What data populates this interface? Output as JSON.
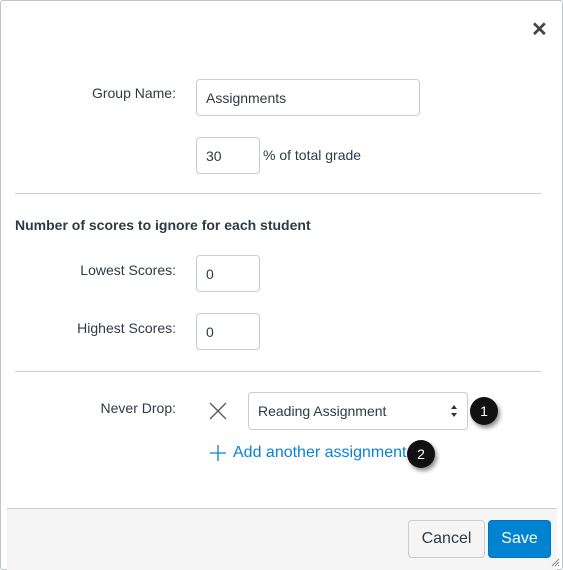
{
  "close_icon": "close-icon",
  "group_name": {
    "label": "Group Name:",
    "value": "Assignments"
  },
  "percent": {
    "value": "30",
    "suffix": "% of total grade"
  },
  "drop_section": {
    "heading": "Number of scores to ignore for each student",
    "lowest": {
      "label": "Lowest Scores:",
      "value": "0"
    },
    "highest": {
      "label": "Highest Scores:",
      "value": "0"
    }
  },
  "never_drop": {
    "label": "Never Drop:",
    "selected": "Reading Assignment",
    "add_link": "Add another assignment"
  },
  "badges": [
    "1",
    "2"
  ],
  "footer": {
    "cancel": "Cancel",
    "save": "Save"
  },
  "colors": {
    "accent": "#0084d1",
    "link": "#0883d6"
  }
}
